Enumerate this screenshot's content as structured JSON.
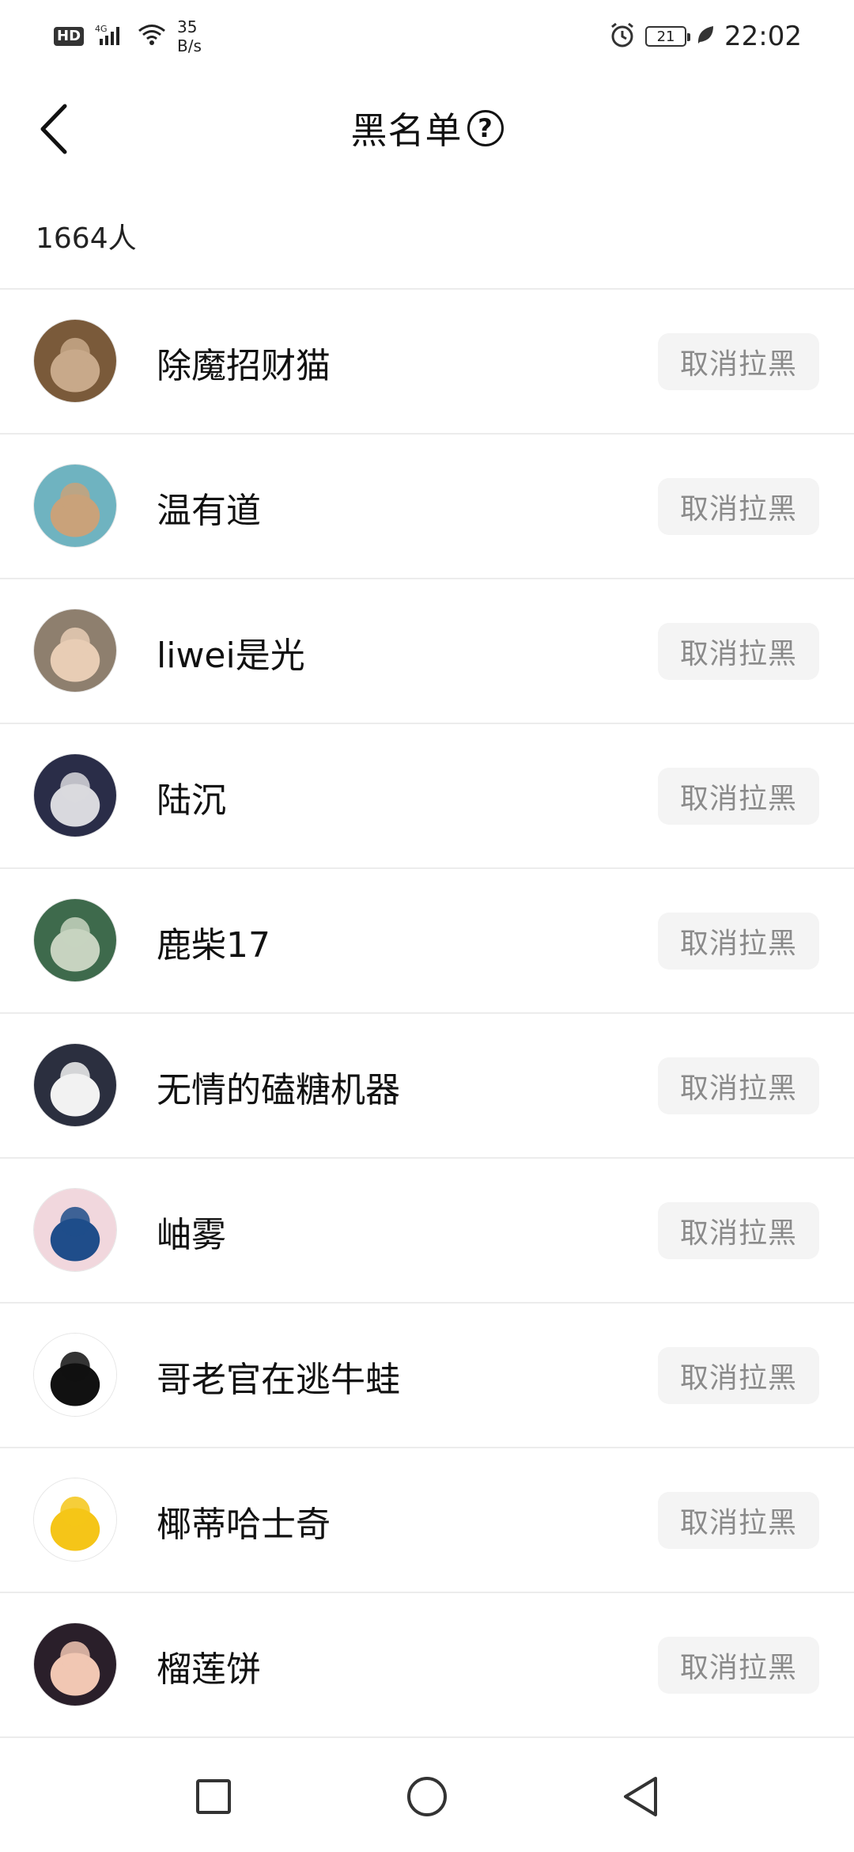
{
  "status_bar": {
    "hd": "HD",
    "network": "4G",
    "speed_value": "35",
    "speed_unit": "B/s",
    "battery": "21",
    "time": "22:02"
  },
  "header": {
    "title": "黑名单",
    "help_symbol": "?"
  },
  "count_label": "1664人",
  "unblock_label": "取消拉黑",
  "users": [
    {
      "name": "除魔招财猫",
      "avatar": "crowd-avatar",
      "colors": [
        "#7a5a3a",
        "#c8a98a"
      ]
    },
    {
      "name": "温有道",
      "avatar": "rabbit-avatar",
      "colors": [
        "#6fb3c0",
        "#c9a27a"
      ]
    },
    {
      "name": "liwei是光",
      "avatar": "child-avatar",
      "colors": [
        "#8e7f6e",
        "#e8cdb5"
      ]
    },
    {
      "name": "陆沉",
      "avatar": "anime-man-avatar",
      "colors": [
        "#2a2d48",
        "#d9d9de"
      ]
    },
    {
      "name": "鹿柴17",
      "avatar": "green-art-avatar",
      "colors": [
        "#3e6a4c",
        "#c7d3c0"
      ]
    },
    {
      "name": "无情的磕糖机器",
      "avatar": "white-dog-avatar",
      "colors": [
        "#2b2f3f",
        "#f2f2f2"
      ]
    },
    {
      "name": "岫雾",
      "avatar": "girl-photo-avatar",
      "colors": [
        "#f1d7dd",
        "#1f4d8a"
      ]
    },
    {
      "name": "哥老官在逃牛蛙",
      "avatar": "panda-meme-avatar",
      "colors": [
        "#ffffff",
        "#111111"
      ]
    },
    {
      "name": "椰蒂哈士奇",
      "avatar": "yellow-chick-avatar",
      "colors": [
        "#ffffff",
        "#f5c518"
      ]
    },
    {
      "name": "榴莲饼",
      "avatar": "cartoon-face-avatar",
      "colors": [
        "#2a1f2a",
        "#f1c7b3"
      ]
    }
  ]
}
